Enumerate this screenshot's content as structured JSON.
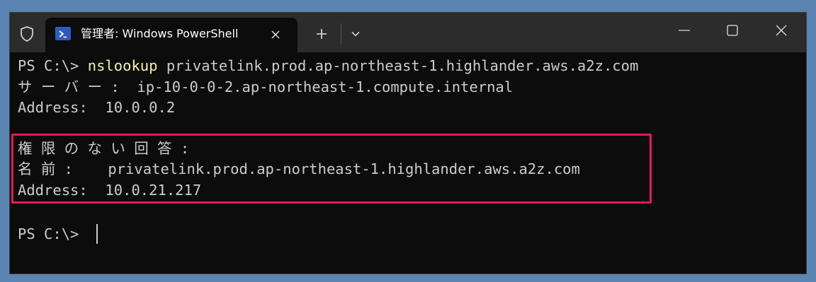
{
  "window": {
    "tab_title": "管理者: Windows PowerShell",
    "icons": {
      "shield": "shield-icon",
      "tab": "powershell-icon",
      "close_tab": "close-icon",
      "new_tab": "plus-icon",
      "dropdown": "chevron-down-icon",
      "minimize": "minimize-icon",
      "maximize": "maximize-icon",
      "close": "close-icon"
    }
  },
  "terminal": {
    "line1": {
      "prompt": "PS C:\\> ",
      "command": "nslookup",
      "args": " privatelink.prod.ap-northeast-1.highlander.aws.a2z.com"
    },
    "line2": "サ ー バ ー :  ip-10-0-0-2.ap-northeast-1.compute.internal",
    "line3": "Address:  10.0.0.2",
    "line4": "権 限 の な い 回 答 :",
    "line5": "名 前 :    privatelink.prod.ap-northeast-1.highlander.aws.a2z.com",
    "line6": "Address:  10.0.21.217",
    "line7": "PS C:\\> "
  },
  "colors": {
    "terminal_bg": "#0c0c0c",
    "text": "#cccccc",
    "command": "#f9f1a5",
    "highlight_border": "#e8175d",
    "titlebar": "#2c2c2c",
    "desktop": "#5b84b3"
  }
}
